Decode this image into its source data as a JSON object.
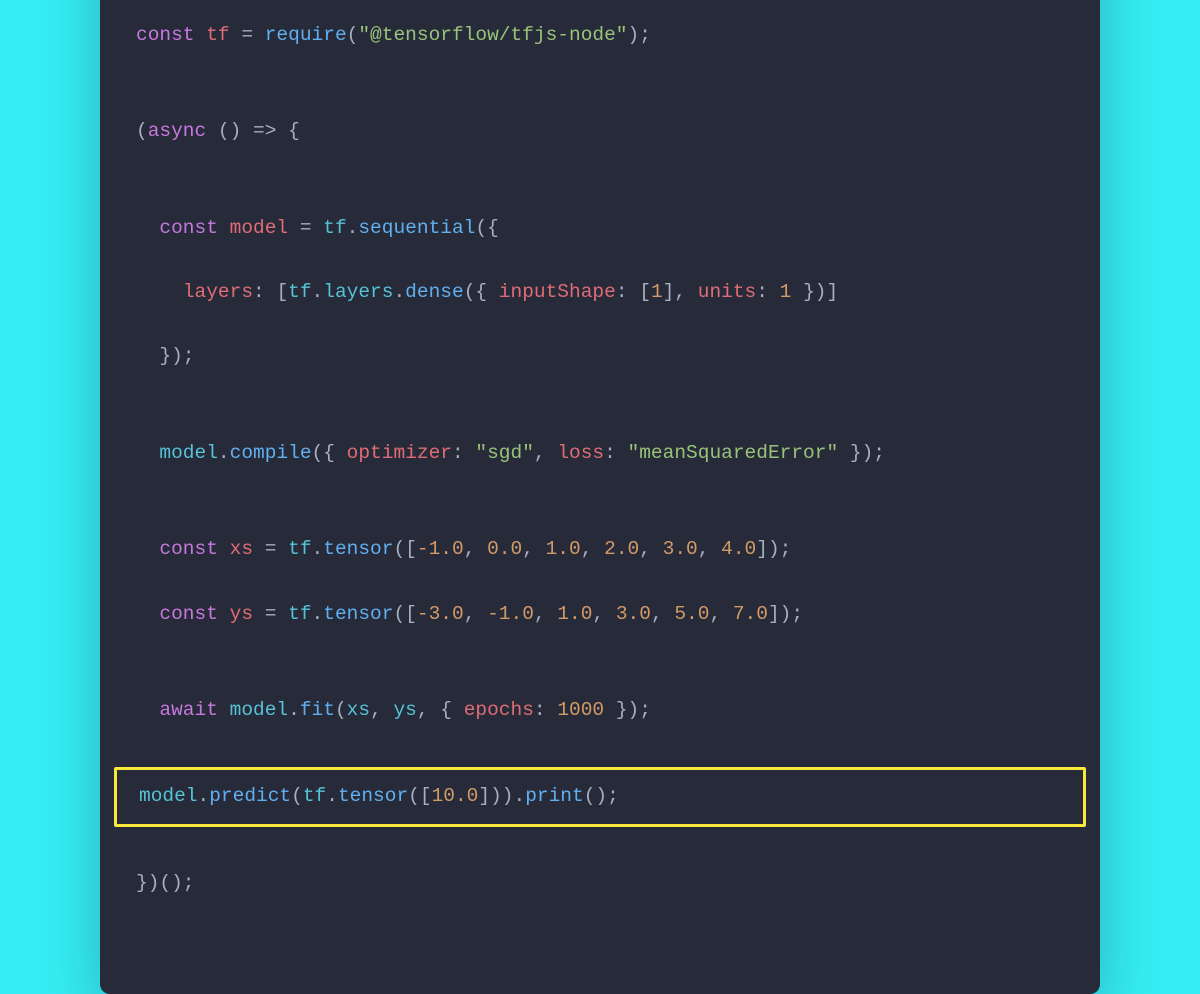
{
  "code": {
    "l1": {
      "kw": "const",
      "id": "tf",
      "eq": "=",
      "req": "require",
      "po": "(",
      "str": "\"@tensorflow/tfjs-node\"",
      "pc": ")",
      "sc": ";"
    },
    "l2": {
      "po": "(",
      "kw": "async",
      "ar": "() => {"
    },
    "l3": {
      "kw": "const",
      "id": "model",
      "eq": "=",
      "tf": "tf",
      "dot": ".",
      "seq": "sequential",
      "po": "({"
    },
    "l4": {
      "key": "layers",
      "col": ":",
      "ob": "[",
      "tf": "tf",
      "d1": ".",
      "lay": "layers",
      "d2": ".",
      "den": "dense",
      "po": "({ ",
      "is": "inputShape",
      "c1": ": [",
      "n1": "1",
      "mid": "], ",
      "un": "units",
      "c2": ": ",
      "n2": "1",
      "pc": " })]"
    },
    "l5": {
      "close": "});"
    },
    "l6": {
      "mdl": "model",
      "d1": ".",
      "cmp": "compile",
      "po": "({ ",
      "opt": "optimizer",
      "c1": ": ",
      "s1": "\"sgd\"",
      "cm": ", ",
      "loss": "loss",
      "c2": ": ",
      "s2": "\"meanSquaredError\"",
      "pc": " });"
    },
    "l7": {
      "kw": "const",
      "id": "xs",
      "eq": "=",
      "tf": "tf",
      "d": ".",
      "ten": "tensor",
      "po": "([",
      "n1": "-1.0",
      "c": ", ",
      "n2": "0.0",
      "n3": "1.0",
      "n4": "2.0",
      "n5": "3.0",
      "n6": "4.0",
      "pc": "]);"
    },
    "l8": {
      "kw": "const",
      "id": "ys",
      "eq": "=",
      "tf": "tf",
      "d": ".",
      "ten": "tensor",
      "po": "([",
      "n1": "-3.0",
      "c": ", ",
      "n2": "-1.0",
      "n3": "1.0",
      "n4": "3.0",
      "n5": "5.0",
      "n6": "7.0",
      "pc": "]);"
    },
    "l9": {
      "kw": "await",
      "mdl": "model",
      "d": ".",
      "fit": "fit",
      "po": "(",
      "xs": "xs",
      "c": ", ",
      "ys": "ys",
      "ob": ", { ",
      "ep": "epochs",
      "col": ": ",
      "n": "1000",
      "pc": " });"
    },
    "l10": {
      "mdl": "model",
      "d1": ".",
      "pred": "predict",
      "po": "(",
      "tf": "tf",
      "d2": ".",
      "ten": "tensor",
      "po2": "([",
      "n": "10.0",
      "pc1": "]))",
      "d3": ".",
      "pr": "print",
      "pc2": "();"
    },
    "l11": {
      "close": "})();"
    }
  }
}
